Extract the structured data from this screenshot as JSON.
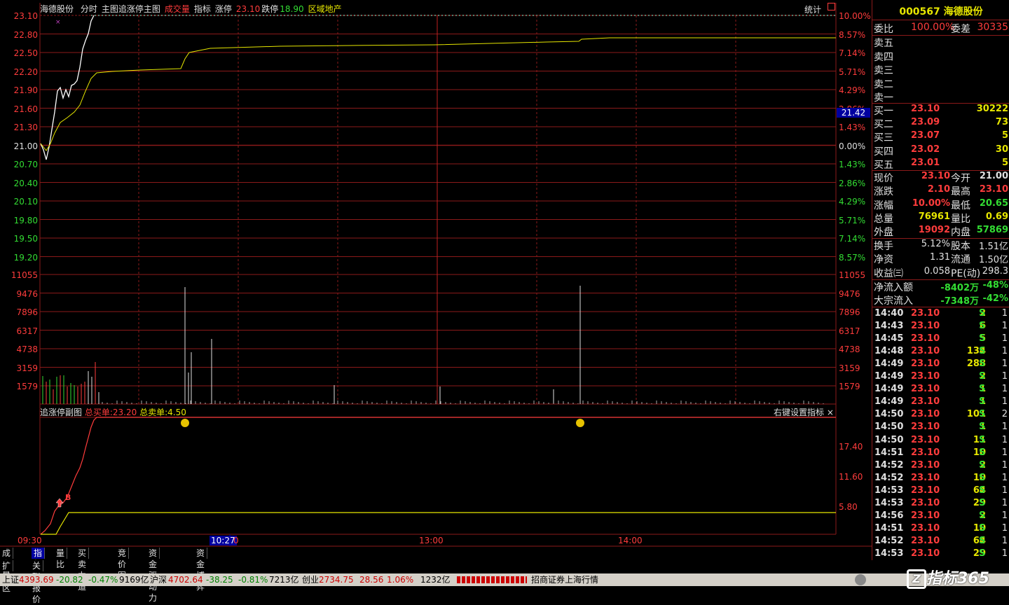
{
  "header": {
    "stock_name": "海德股份",
    "tab_fenshi": "分时",
    "main_chart": "主图追涨停主图",
    "volume": "成交量",
    "indicator": "指标",
    "limit_up_label": "涨停",
    "limit_up_value": "23.10",
    "limit_down_label": "跌停",
    "limit_down_value": "18.90",
    "sector": "区域地产",
    "stats_button": "统计"
  },
  "price_axis": {
    "left": [
      "23.10",
      "22.80",
      "22.50",
      "22.20",
      "21.90",
      "21.60",
      "21.30",
      "21.00",
      "20.70",
      "20.40",
      "20.10",
      "19.80",
      "19.50",
      "19.20"
    ],
    "right": [
      "10.00%",
      "8.57%",
      "7.14%",
      "5.71%",
      "4.29%",
      "2.86%",
      "1.43%",
      "0.00%",
      "1.43%",
      "2.86%",
      "4.29%",
      "5.71%",
      "7.14%",
      "8.57%"
    ],
    "cursor_value": "21.42"
  },
  "volume_axis": [
    "11055",
    "9476",
    "7896",
    "6317",
    "4738",
    "3159",
    "1579"
  ],
  "sub_chart": {
    "title": "追涨停副图",
    "total_buy_label": "总买单:",
    "total_buy_value": "23.20",
    "total_sell_label": "总卖单:",
    "total_sell_value": "4.50",
    "settings": "右键设置指标",
    "close_glyph": "×",
    "axis": [
      "17.40",
      "11.60",
      "5.80"
    ],
    "marker": "B"
  },
  "time_axis": [
    "09:30",
    "10:27",
    "0",
    "13:00",
    "14:00"
  ],
  "bottom_tabs": [
    "成交量",
    "指标",
    "量比",
    "买卖力道",
    "竞价图",
    "资金驱动力",
    "资金博弈"
  ],
  "bottom_tabs2": [
    "扩展区",
    "关联报价"
  ],
  "right_panel": {
    "code": "000567",
    "name": "海德股份",
    "weibi_label": "委比",
    "weibi": "100.00%",
    "weicha_label": "委差",
    "weicha": "30335",
    "sells": [
      {
        "label": "卖五"
      },
      {
        "label": "卖四"
      },
      {
        "label": "卖三"
      },
      {
        "label": "卖二"
      },
      {
        "label": "卖一"
      }
    ],
    "buys": [
      {
        "label": "买一",
        "price": "23.10",
        "vol": "30222"
      },
      {
        "label": "买二",
        "price": "23.09",
        "vol": "73"
      },
      {
        "label": "买三",
        "price": "23.07",
        "vol": "5"
      },
      {
        "label": "买四",
        "price": "23.02",
        "vol": "30"
      },
      {
        "label": "买五",
        "price": "23.01",
        "vol": "5"
      }
    ],
    "quotes": [
      {
        "l1": "现价",
        "v1": "23.10",
        "l2": "今开",
        "v2": "21.00"
      },
      {
        "l1": "涨跌",
        "v1": "2.10",
        "l2": "最高",
        "v2": "23.10"
      },
      {
        "l1": "涨幅",
        "v1": "10.00%",
        "l2": "最低",
        "v2": "20.65"
      },
      {
        "l1": "总量",
        "v1": "76961",
        "l2": "量比",
        "v2": "0.69"
      },
      {
        "l1": "外盘",
        "v1": "19092",
        "l2": "内盘",
        "v2": "57869"
      }
    ],
    "funds": [
      {
        "l1": "换手",
        "v1": "5.12%",
        "l2": "股本",
        "v2": "1.51亿"
      },
      {
        "l1": "净资",
        "v1": "1.31",
        "l2": "流通",
        "v2": "1.50亿"
      },
      {
        "l1": "收益㈢",
        "v1": "0.058",
        "l2": "PE(动)",
        "v2": "298.3"
      }
    ],
    "flows": [
      {
        "label": "净流入额",
        "value": "-8402万",
        "pct": "-48%"
      },
      {
        "label": "大宗流入",
        "value": "-7348万",
        "pct": "-42%"
      }
    ],
    "ticks": [
      {
        "t": "14:40",
        "p": "23.10",
        "v": "2",
        "s": "S",
        "n": "1"
      },
      {
        "t": "14:43",
        "p": "23.10",
        "v": "6",
        "s": "S",
        "n": "1"
      },
      {
        "t": "14:45",
        "p": "23.10",
        "v": "5",
        "s": "S",
        "n": "1"
      },
      {
        "t": "14:48",
        "p": "23.10",
        "v": "134",
        "s": "S",
        "n": "1"
      },
      {
        "t": "14:49",
        "p": "23.10",
        "v": "288",
        "s": "S",
        "n": "1"
      },
      {
        "t": "14:49",
        "p": "23.10",
        "v": "2",
        "s": "S",
        "n": "1"
      },
      {
        "t": "14:49",
        "p": "23.10",
        "v": "1",
        "s": "S",
        "n": "1"
      },
      {
        "t": "14:49",
        "p": "23.10",
        "v": "1",
        "s": "S",
        "n": "1"
      },
      {
        "t": "14:50",
        "p": "23.10",
        "v": "101",
        "s": "S",
        "n": "2"
      },
      {
        "t": "14:50",
        "p": "23.10",
        "v": "1",
        "s": "S",
        "n": "1"
      },
      {
        "t": "14:50",
        "p": "23.10",
        "v": "11",
        "s": "S",
        "n": "1"
      },
      {
        "t": "14:51",
        "p": "23.10",
        "v": "10",
        "s": "S",
        "n": "1"
      },
      {
        "t": "14:52",
        "p": "23.10",
        "v": "2",
        "s": "S",
        "n": "1"
      },
      {
        "t": "14:52",
        "p": "23.10",
        "v": "10",
        "s": "S",
        "n": "1"
      },
      {
        "t": "14:53",
        "p": "23.10",
        "v": "64",
        "s": "S",
        "n": "1"
      },
      {
        "t": "14:53",
        "p": "23.10",
        "v": "29",
        "s": "S",
        "n": "1"
      },
      {
        "t": "14:56",
        "p": "23.10",
        "v": "2",
        "s": "S",
        "n": "1"
      },
      {
        "t": "14:51",
        "p": "23.10",
        "v": "10",
        "s": "S",
        "n": "1"
      },
      {
        "t": "14:52",
        "p": "23.10",
        "v": "64",
        "s": "S",
        "n": "1"
      },
      {
        "t": "14:53",
        "p": "23.10",
        "v": "29",
        "s": "S",
        "n": "1"
      }
    ]
  },
  "status_bar": {
    "sh_label": "上证",
    "sh_value": "4393.69",
    "sh_chg": "-20.82",
    "sh_pct": "-0.47%",
    "sh_amt": "9169亿",
    "sz_label": "沪深",
    "sz_value": "4702.64",
    "sz_chg": "-38.25",
    "sz_pct": "-0.81%",
    "sz_amt": "7213亿",
    "cy_label": "创业",
    "cy_value": "2734.75",
    "cy_chg": "28.56",
    "cy_pct": "1.06%",
    "cy_amt": "1232亿",
    "broker": "招商证券上海行情",
    "logo_text": "指标365"
  },
  "colors": {
    "up": "#ff3c3c",
    "down": "#33dd33",
    "grid": "#8b1a1a",
    "price_line": "#ffffff",
    "avg_line": "#e6e600"
  }
}
